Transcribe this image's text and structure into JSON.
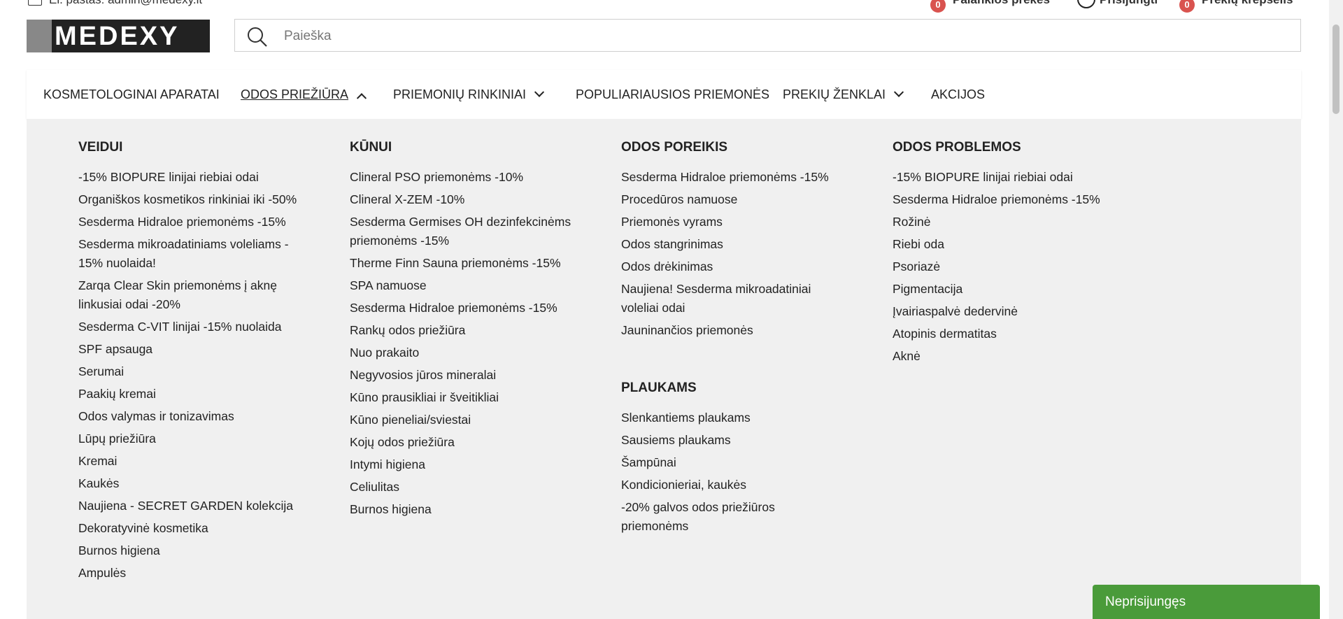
{
  "top": {
    "email": "El. paštas: admin@medexy.lt",
    "fav_count": "0",
    "fav_label": "Palankios prekės",
    "login_label": "Prisijungti",
    "cart_count": "0",
    "cart_label": "Prekių krepšelis"
  },
  "logo_text": "MEDEXY",
  "search": {
    "placeholder": "Paieška"
  },
  "nav": {
    "items": [
      {
        "label": "KOSMETOLOGINAI APARATAI"
      },
      {
        "label": "ODOS PRIEŽIŪRA"
      },
      {
        "label": "PRIEMONIŲ RINKINIAI"
      },
      {
        "label": "POPULIARIAUSIOS PRIEMONĖS"
      },
      {
        "label": "PREKIŲ ŽENKLAI"
      },
      {
        "label": "AKCIJOS"
      }
    ]
  },
  "mega": {
    "veidui": {
      "title": "VEIDUI",
      "items": [
        "-15% BIOPURE linijai riebiai odai",
        "Organiškos kosmetikos rinkiniai iki -50%",
        "Sesderma Hidraloe priemonėms -15%",
        "Sesderma mikroadatiniams voleliams - 15% nuolaida!",
        "Zarqa Clear Skin priemonėms į aknę linkusiai odai -20%",
        "Sesderma C-VIT linijai -15% nuolaida",
        "SPF apsauga",
        "Serumai",
        "Paakių kremai",
        "Odos valymas ir tonizavimas",
        "Lūpų priežiūra",
        "Kremai",
        "Kaukės",
        "Naujiena - SECRET GARDEN kolekcija",
        "Dekoratyvinė kosmetika",
        "Burnos higiena",
        "Ampulės"
      ]
    },
    "kunui": {
      "title": "KŪNUI",
      "items": [
        "Clineral PSO priemonėms -10%",
        "Clineral X-ZEM -10%",
        "Sesderma Germises OH dezinfekcinėms priemonėms -15%",
        "Therme Finn Sauna priemonėms -15%",
        "SPA namuose",
        "Sesderma Hidraloe priemonėms -15%",
        "Rankų odos priežiūra",
        "Nuo prakaito",
        "Negyvosios jūros mineralai",
        "Kūno prausikliai ir šveitikliai",
        "Kūno pieneliai/sviestai",
        "Kojų odos priežiūra",
        "Intymi higiena",
        "Celiulitas",
        "Burnos higiena"
      ]
    },
    "poreikis": {
      "title": "ODOS POREIKIS",
      "items": [
        "Sesderma Hidraloe priemonėms -15%",
        "Procedūros namuose",
        "Priemonės vyrams",
        "Odos stangrinimas",
        "Odos drėkinimas",
        "Naujiena! Sesderma mikroadatiniai voleliai odai",
        "Jauninančios priemonės"
      ]
    },
    "plaukams": {
      "title": "PLAUKAMS",
      "items": [
        "Slenkantiems plaukams",
        "Sausiems plaukams",
        "Šampūnai",
        "Kondicionieriai, kaukės",
        "-20% galvos odos priežiūros priemonėms"
      ]
    },
    "problemos": {
      "title": "ODOS PROBLEMOS",
      "items": [
        "-15% BIOPURE linijai riebiai odai",
        "Sesderma Hidraloe priemonėms -15%",
        "Rožinė",
        "Riebi oda",
        "Psoriazė",
        "Pigmentacija",
        "Įvairiaspalvė dedervinė",
        "Atopinis dermatitas",
        "Aknė"
      ]
    }
  },
  "chat": {
    "label": "Neprisijungęs"
  },
  "colors": {
    "chat_bg": "#4a9b3a",
    "badge": "#d9534f",
    "menu_bg": "#f0f0f0"
  }
}
